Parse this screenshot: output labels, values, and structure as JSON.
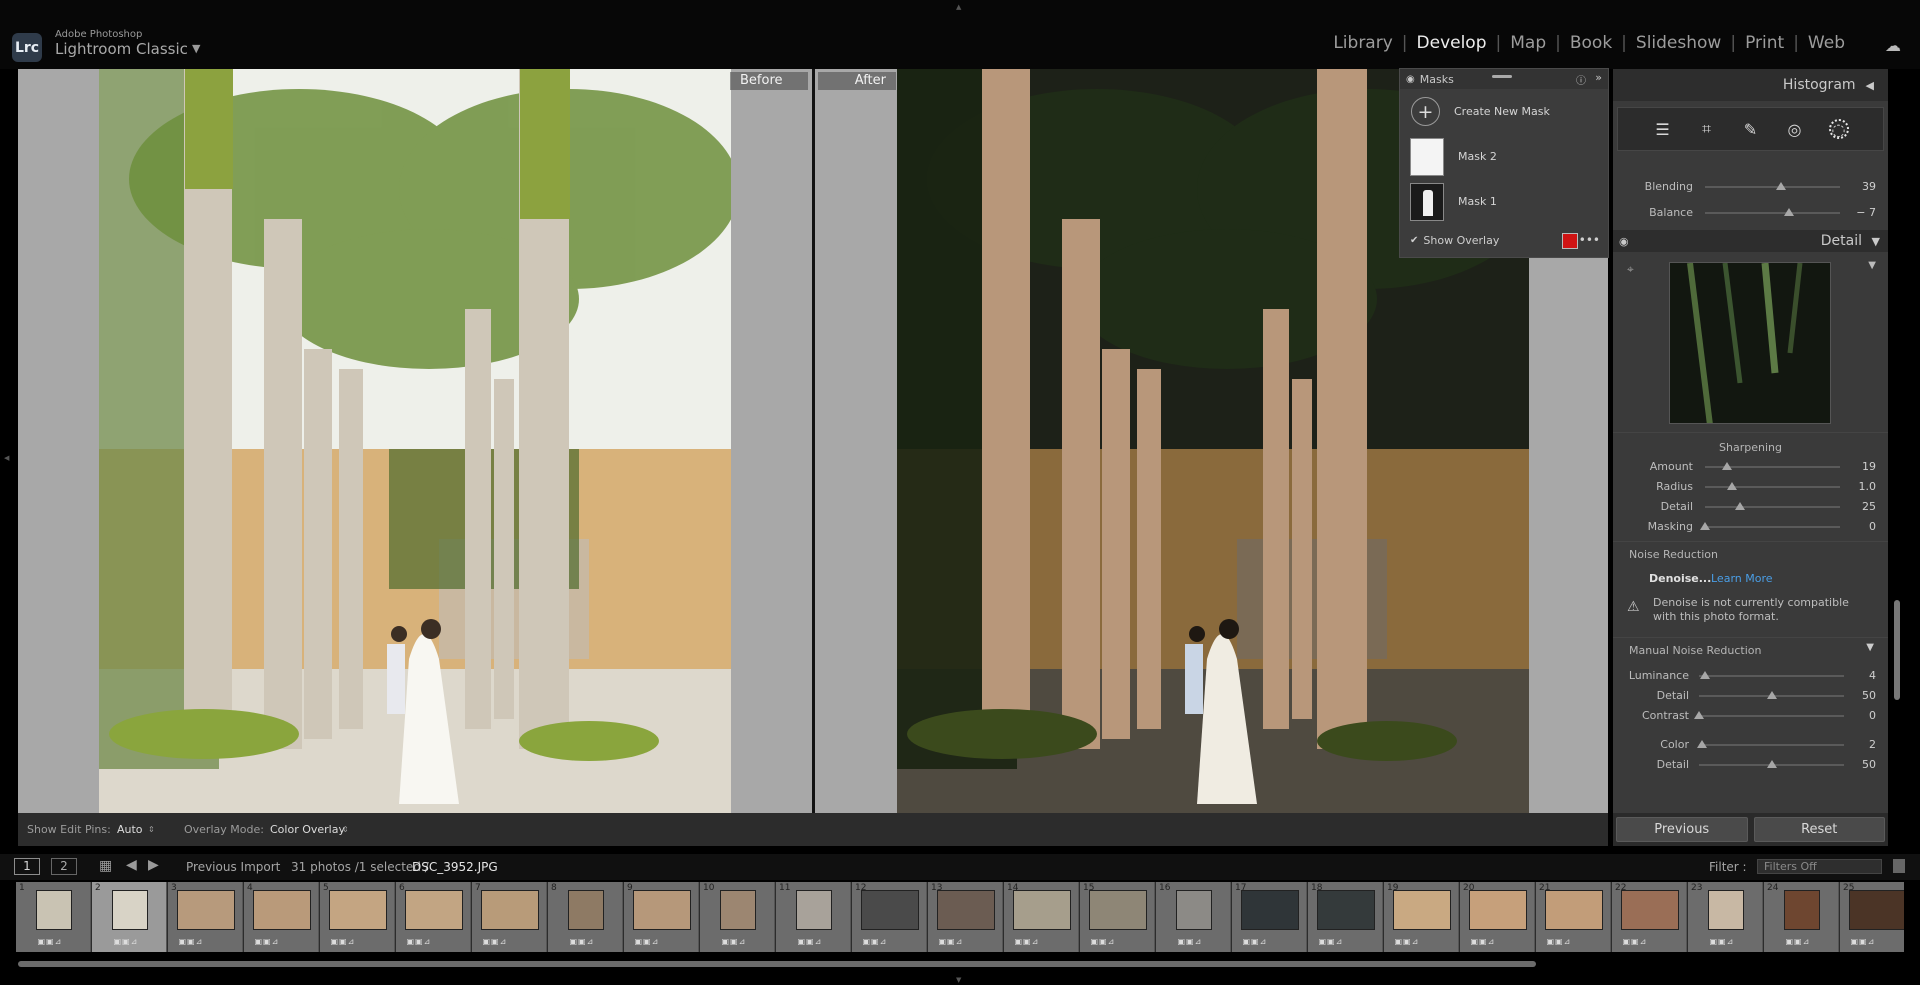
{
  "app": {
    "brand_small": "Adobe Photoshop",
    "brand_name": "Lightroom Classic",
    "logo_text": "Lrc"
  },
  "modules": [
    {
      "label": "Library",
      "active": false
    },
    {
      "label": "Develop",
      "active": true
    },
    {
      "label": "Map",
      "active": false
    },
    {
      "label": "Book",
      "active": false
    },
    {
      "label": "Slideshow",
      "active": false
    },
    {
      "label": "Print",
      "active": false
    },
    {
      "label": "Web",
      "active": false
    }
  ],
  "compare": {
    "before_label": "Before",
    "after_label": "After"
  },
  "masks": {
    "title": "Masks",
    "create_label": "Create New Mask",
    "items": [
      {
        "label": "Mask 2"
      },
      {
        "label": "Mask 1"
      }
    ],
    "show_overlay_label": "Show Overlay",
    "overlay_color": "#d01414"
  },
  "right_panel": {
    "histogram_title": "Histogram",
    "blending": {
      "label": "Blending",
      "value": "39",
      "level": 0.56
    },
    "balance": {
      "label": "Balance",
      "value": "− 7",
      "level": 0.62
    },
    "detail_title": "Detail",
    "sharpening": {
      "title": "Sharpening",
      "sliders": [
        {
          "label": "Amount",
          "value": "19",
          "level": 0.16
        },
        {
          "label": "Radius",
          "value": "1.0",
          "level": 0.2
        },
        {
          "label": "Detail",
          "value": "25",
          "level": 0.26
        },
        {
          "label": "Masking",
          "value": "0",
          "level": 0.0
        }
      ]
    },
    "noise": {
      "title": "Noise Reduction",
      "denoise_label": "Denoise...",
      "learn_more": "Learn More",
      "warning": "Denoise is not currently compatible with this photo format."
    },
    "manual_noise": {
      "title": "Manual Noise Reduction",
      "sliders": [
        {
          "label": "Luminance",
          "value": "4",
          "level": 0.04
        },
        {
          "label": "Detail",
          "value": "50",
          "level": 0.5
        },
        {
          "label": "Contrast",
          "value": "0",
          "level": 0.0
        },
        {
          "label": "Color",
          "value": "2",
          "level": 0.02
        },
        {
          "label": "Detail",
          "value": "50",
          "level": 0.5
        }
      ]
    },
    "previous_label": "Previous",
    "reset_label": "Reset"
  },
  "toolbar": {
    "edit_pins_label": "Show Edit Pins:",
    "edit_pins_value": "Auto",
    "overlay_mode_label": "Overlay Mode:",
    "overlay_mode_value": "Color Overlay"
  },
  "filmstrip_header": {
    "screen1": "1",
    "screen2": "2",
    "source": "Previous Import",
    "count": "31 photos /1 selected /",
    "filename": "DSC_3952.JPG",
    "filter_label": "Filter :",
    "filter_value": "Filters Off"
  },
  "filmstrip": [
    {
      "num": "1",
      "tone": "#c9c3b3",
      "wide": false
    },
    {
      "num": "2",
      "tone": "#d8d3c6",
      "wide": false,
      "selected": true
    },
    {
      "num": "3",
      "tone": "#b79a7c",
      "wide": true
    },
    {
      "num": "4",
      "tone": "#b99a7a",
      "wide": true
    },
    {
      "num": "5",
      "tone": "#c4a582",
      "wide": true
    },
    {
      "num": "6",
      "tone": "#c2a583",
      "wide": true
    },
    {
      "num": "7",
      "tone": "#b89b79",
      "wide": true
    },
    {
      "num": "8",
      "tone": "#8e7a64",
      "wide": false
    },
    {
      "num": "9",
      "tone": "#b6987a",
      "wide": true
    },
    {
      "num": "10",
      "tone": "#9c8671",
      "wide": false
    },
    {
      "num": "11",
      "tone": "#a8a29a",
      "wide": false
    },
    {
      "num": "12",
      "tone": "#4a4a4a",
      "wide": true
    },
    {
      "num": "13",
      "tone": "#6b5c52",
      "wide": true
    },
    {
      "num": "14",
      "tone": "#a69e8c",
      "wide": true
    },
    {
      "num": "15",
      "tone": "#8e8676",
      "wide": true
    },
    {
      "num": "16",
      "tone": "#8c8a86",
      "wide": false
    },
    {
      "num": "17",
      "tone": "#2f3538",
      "wide": true
    },
    {
      "num": "18",
      "tone": "#343a3b",
      "wide": true
    },
    {
      "num": "19",
      "tone": "#c9a982",
      "wide": true
    },
    {
      "num": "20",
      "tone": "#c6a07b",
      "wide": true
    },
    {
      "num": "21",
      "tone": "#c29d79",
      "wide": true
    },
    {
      "num": "22",
      "tone": "#9a6e56",
      "wide": true
    },
    {
      "num": "23",
      "tone": "#c8b8a4",
      "wide": false
    },
    {
      "num": "24",
      "tone": "#6e4630",
      "wide": false
    },
    {
      "num": "25",
      "tone": "#4b3426",
      "wide": true
    }
  ]
}
